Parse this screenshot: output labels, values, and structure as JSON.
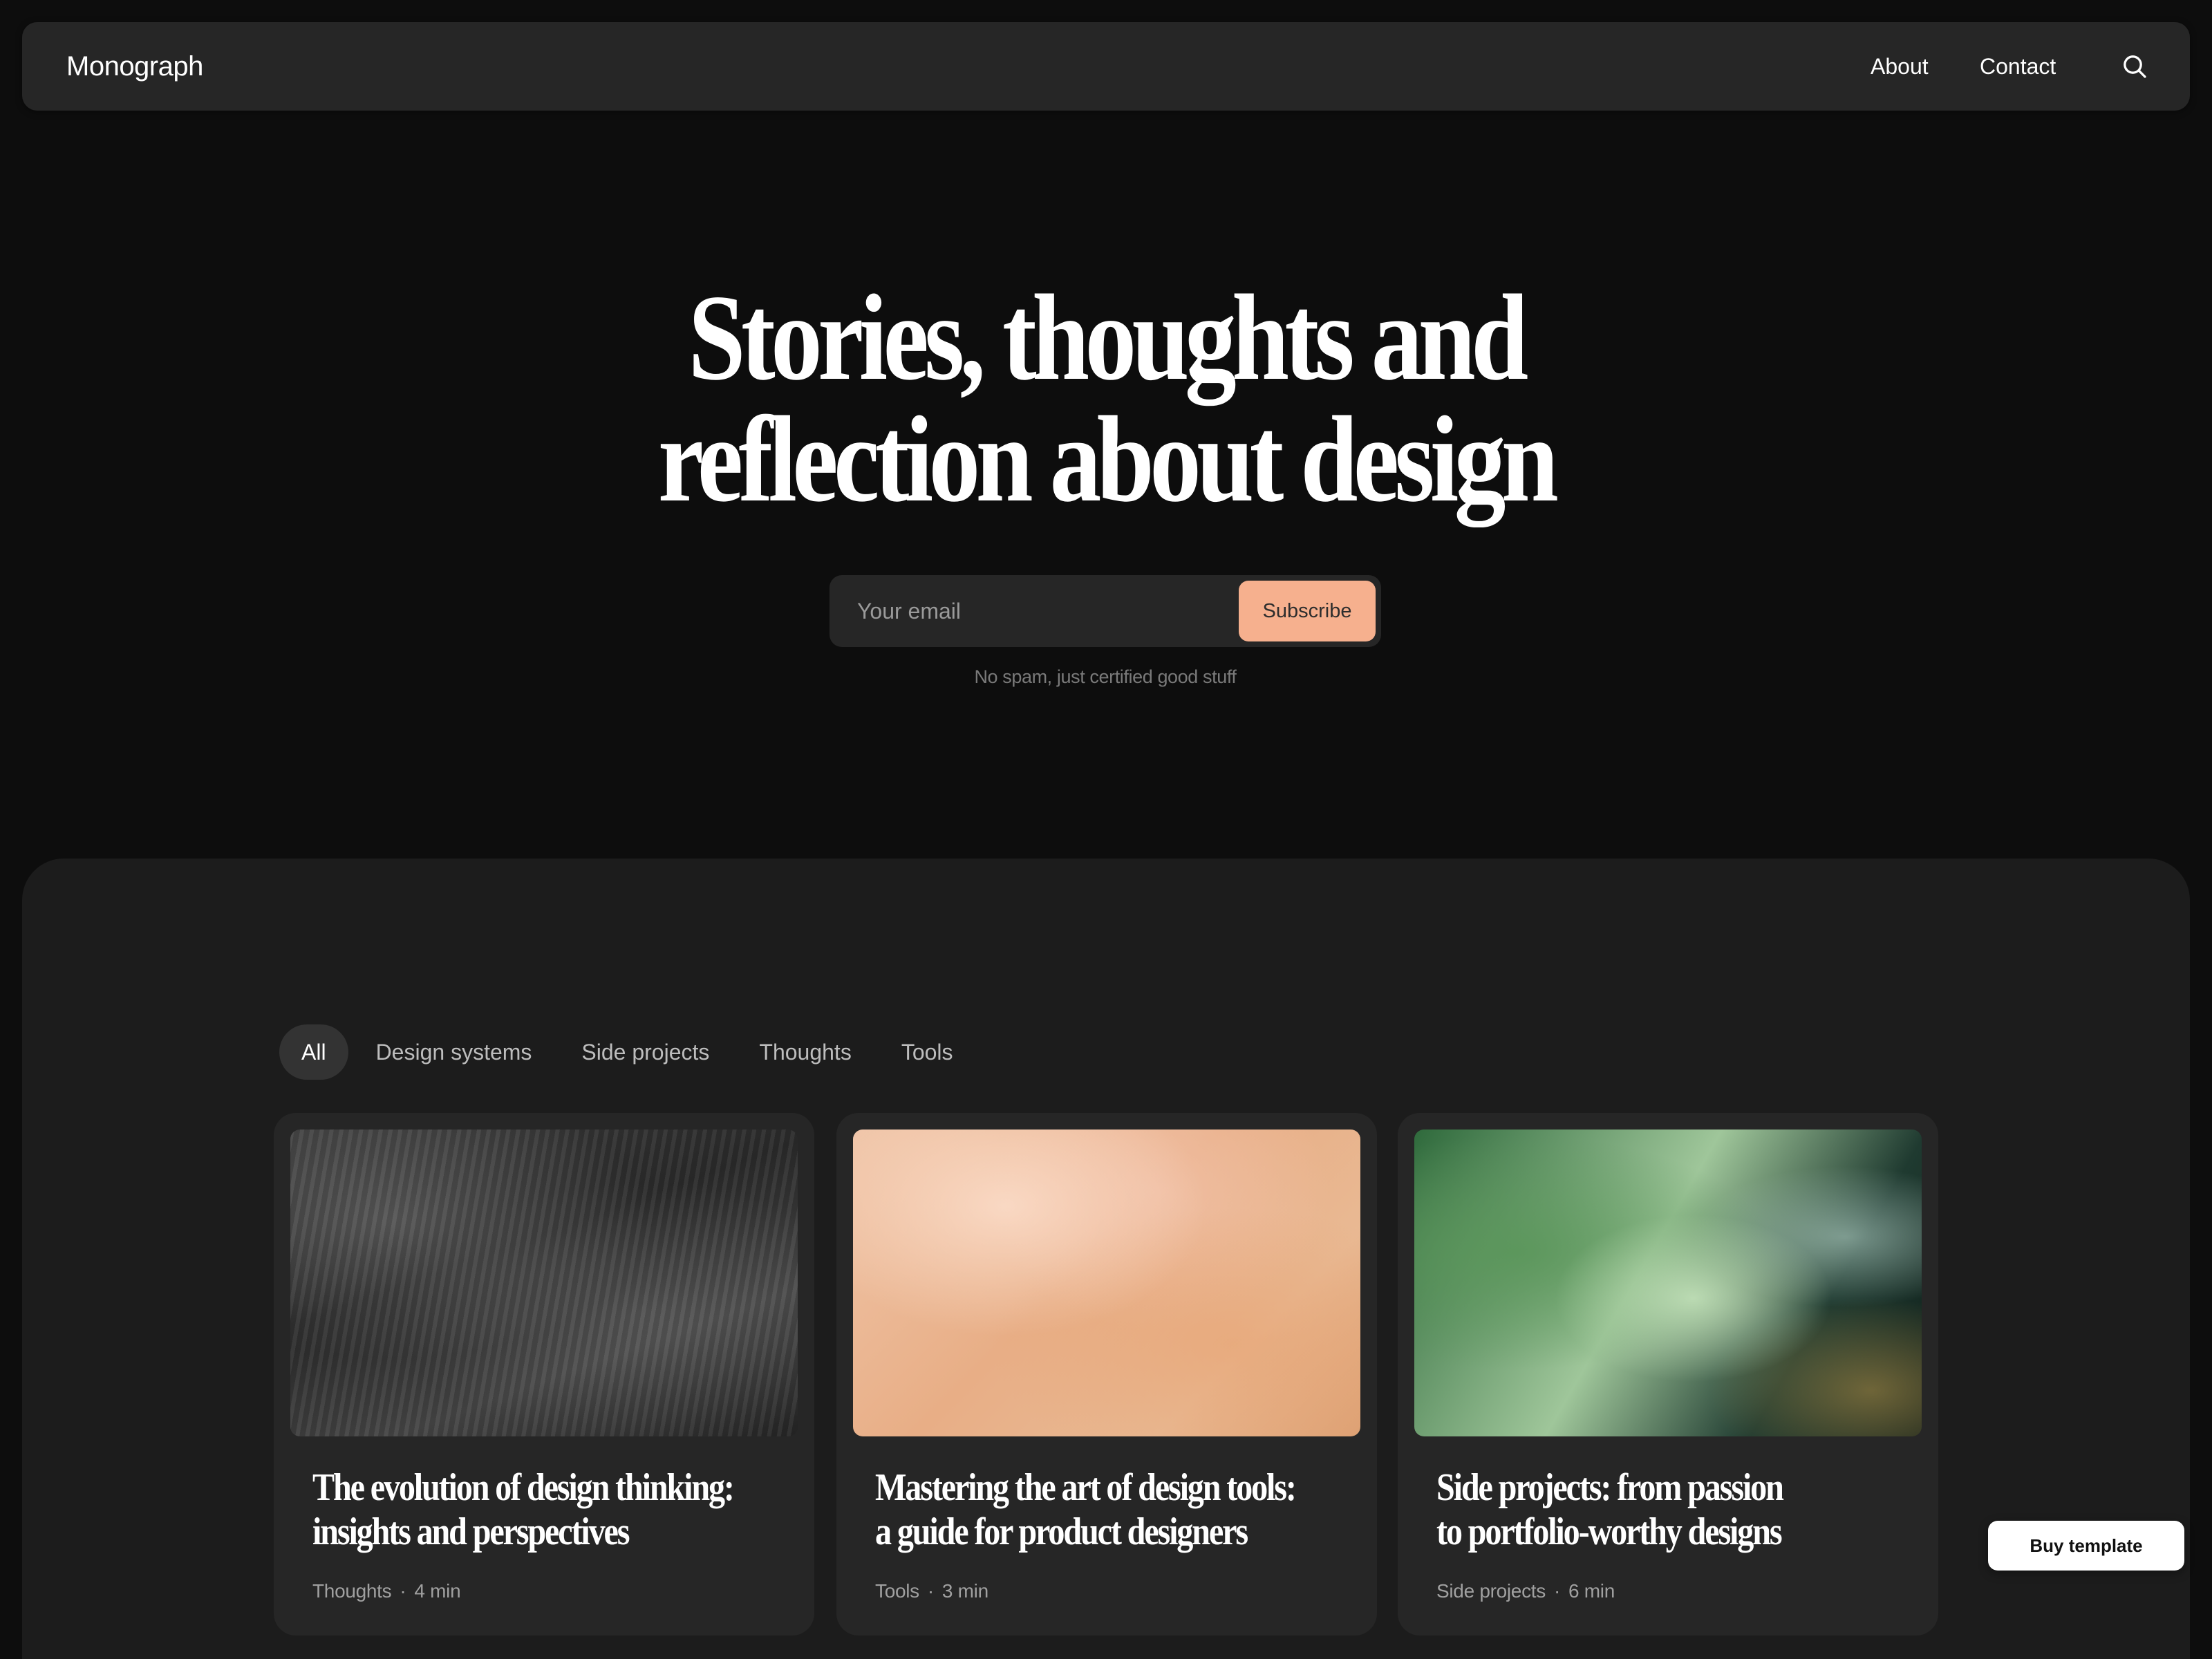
{
  "nav": {
    "brand": "Monograph",
    "about": "About",
    "contact": "Contact",
    "search_icon": "search-icon"
  },
  "hero": {
    "title": "Stories, thoughts and reflection about design",
    "email_placeholder": "Your email",
    "subscribe_label": "Subscribe",
    "note": "No spam, just certified good stuff",
    "accent_color": "#f6b08e"
  },
  "filters": {
    "tabs": [
      {
        "label": "All",
        "active": true
      },
      {
        "label": "Design systems",
        "active": false
      },
      {
        "label": "Side projects",
        "active": false
      },
      {
        "label": "Thoughts",
        "active": false
      },
      {
        "label": "Tools",
        "active": false
      }
    ]
  },
  "posts": [
    {
      "title": "The evolution of design thinking:\ninsights and perspectives",
      "category": "Thoughts",
      "read_time": "4 min",
      "image": "dark-grey-brushed-texture"
    },
    {
      "title": "Mastering the art of design tools:\na guide for product designers",
      "category": "Tools",
      "read_time": "3 min",
      "image": "peach-marble-texture"
    },
    {
      "title": "Side projects: from passion\nto portfolio-worthy designs",
      "category": "Side projects",
      "read_time": "6 min",
      "image": "blurred-green-glass"
    }
  ],
  "buy_template": "Buy template"
}
